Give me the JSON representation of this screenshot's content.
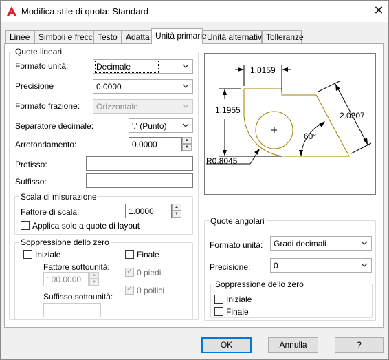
{
  "window": {
    "title": "Modifica stile di quota: Standard",
    "close_glyph": "✕"
  },
  "tabs": [
    {
      "label": "Linee"
    },
    {
      "label": "Simboli e frecce"
    },
    {
      "label": "Testo"
    },
    {
      "label": "Adatta"
    },
    {
      "label": "Unità primarie",
      "active": true
    },
    {
      "label": "Unità alternative"
    },
    {
      "label": "Tolleranze"
    }
  ],
  "linear": {
    "group_title": "Quote lineari",
    "unit_format_label": "Formato unità:",
    "unit_format_value": "Decimale",
    "precision_label": "Precisione",
    "precision_value": "0.0000",
    "fraction_format_label": "Formato frazione:",
    "fraction_format_value": "Orizzontale",
    "decimal_sep_label": "Separatore decimale:",
    "decimal_sep_value": "'.' (Punto)",
    "roundoff_label": "Arrotondamento:",
    "roundoff_value": "0.0000",
    "prefix_label": "Prefisso:",
    "prefix_value": "",
    "suffix_label": "Suffisso:",
    "suffix_value": ""
  },
  "scale": {
    "group_title": "Scala di misurazione",
    "factor_label": "Fattore di scala:",
    "factor_value": "1.0000",
    "layout_only_label": "Applica solo a quote di layout",
    "layout_only_checked": false
  },
  "zero_linear": {
    "group_title": "Soppressione dello zero",
    "leading_label": "Iniziale",
    "trailing_label": "Finale",
    "sub_factor_label": "Fattore sottounità:",
    "sub_factor_value": "100.0000",
    "sub_suffix_label": "Suffisso sottounità:",
    "sub_suffix_value": "",
    "feet_label": "0 piedi",
    "inches_label": "0 pollici"
  },
  "angular": {
    "group_title": "Quote angolari",
    "unit_format_label": "Formato unità:",
    "unit_format_value": "Gradi decimali",
    "precision_label": "Precisione:",
    "precision_value": "0",
    "zero_group_title": "Soppressione dello zero",
    "leading_label": "Iniziale",
    "trailing_label": "Finale"
  },
  "preview": {
    "dim_top": "1.0159",
    "dim_left": "1.1955",
    "dim_right": "2.0207",
    "dim_angle": "60°",
    "dim_radius": "R0.8045"
  },
  "buttons": {
    "ok": "OK",
    "cancel": "Annulla",
    "help": "?"
  },
  "colors": {
    "accent": "#0078d7",
    "preview_geometry": "#a08000",
    "app_icon": "#d6202a"
  }
}
